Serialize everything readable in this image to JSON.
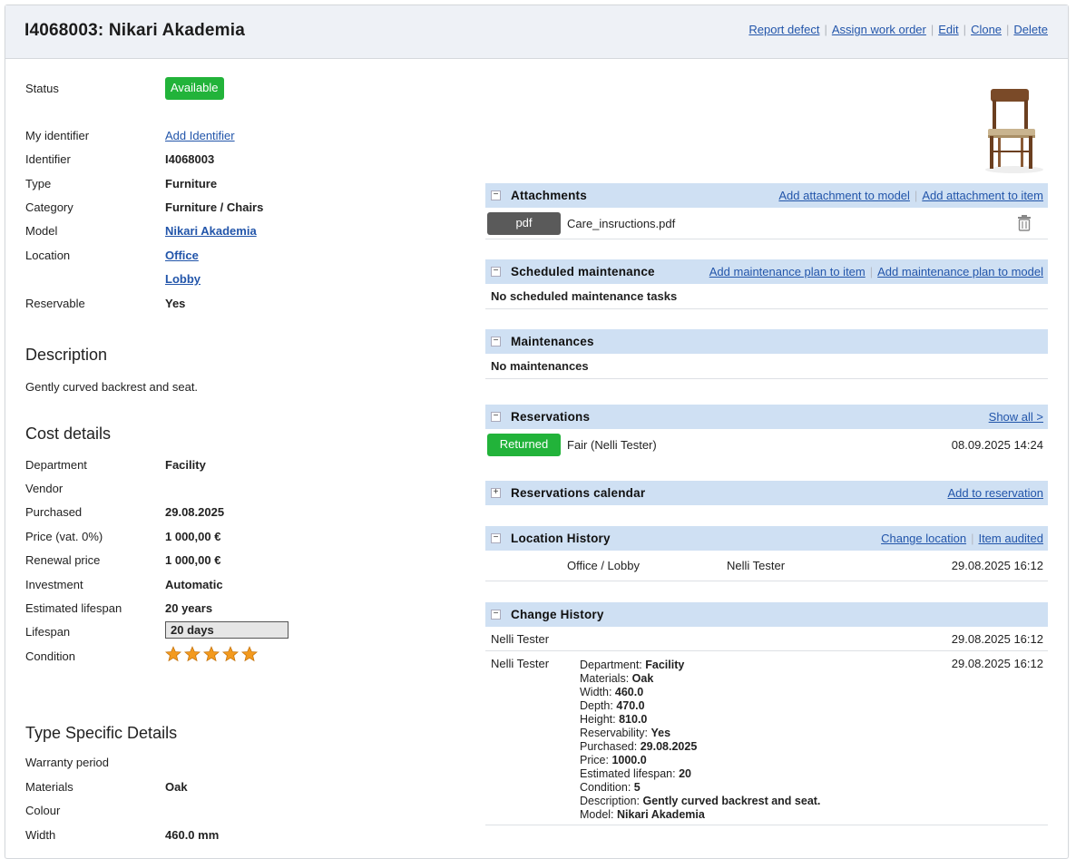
{
  "header": {
    "title": "I4068003: Nikari Akademia",
    "actions": [
      "Report defect",
      "Assign work order",
      "Edit",
      "Clone",
      "Delete"
    ]
  },
  "item": {
    "status_label": "Status",
    "status_value": "Available",
    "my_identifier_label": "My identifier",
    "my_identifier_link": "Add Identifier",
    "identifier_label": "Identifier",
    "identifier_value": "I4068003",
    "type_label": "Type",
    "type_value": "Furniture",
    "category_label": "Category",
    "category_value": "Furniture / Chairs",
    "model_label": "Model",
    "model_value": "Nikari Akademia",
    "location_label": "Location",
    "location_1": "Office",
    "location_2": "Lobby",
    "reservable_label": "Reservable",
    "reservable_value": "Yes"
  },
  "description": {
    "heading": "Description",
    "text": "Gently curved backrest and seat."
  },
  "cost": {
    "heading": "Cost details",
    "department_label": "Department",
    "department_value": "Facility",
    "vendor_label": "Vendor",
    "purchased_label": "Purchased",
    "purchased_value": "29.08.2025",
    "price_label": "Price (vat. 0%)",
    "price_value": "1 000,00 €",
    "renewal_label": "Renewal price",
    "renewal_value": "1 000,00 €",
    "investment_label": "Investment",
    "investment_value": "Automatic",
    "est_lifespan_label": "Estimated lifespan",
    "est_lifespan_value": "20 years",
    "lifespan_label": "Lifespan",
    "lifespan_value": "20 days",
    "condition_label": "Condition",
    "condition_stars": 5,
    "star_color": "#f39a1e"
  },
  "type_specific": {
    "heading": "Type Specific Details",
    "warranty_label": "Warranty period",
    "materials_label": "Materials",
    "materials_value": "Oak",
    "colour_label": "Colour",
    "width_label": "Width",
    "width_value": "460.0 mm"
  },
  "attachments": {
    "title": "Attachments",
    "links": [
      "Add attachment to model",
      "Add attachment to item"
    ],
    "file_type": "pdf",
    "file_name": "Care_insructions.pdf"
  },
  "scheduled": {
    "title": "Scheduled maintenance",
    "links": [
      "Add maintenance plan to item",
      "Add maintenance plan to model"
    ],
    "empty": "No scheduled maintenance tasks"
  },
  "maintenances": {
    "title": "Maintenances",
    "empty": "No maintenances"
  },
  "reservations": {
    "title": "Reservations",
    "link": "Show all >",
    "status": "Returned",
    "who": "Fair (Nelli Tester)",
    "date": "08.09.2025 14:24"
  },
  "calendar": {
    "title": "Reservations calendar",
    "link": "Add to reservation"
  },
  "location_history": {
    "title": "Location History",
    "links": [
      "Change location",
      "Item audited"
    ],
    "place": "Office / Lobby",
    "user": "Nelli Tester",
    "date": "29.08.2025 16:12"
  },
  "change_history": {
    "title": "Change History",
    "row1_user": "Nelli Tester",
    "row1_date": "29.08.2025 16:12",
    "row2_user": "Nelli Tester",
    "row2_date": "29.08.2025 16:12",
    "changes": [
      {
        "k": "Department:",
        "v": "Facility"
      },
      {
        "k": "Materials:",
        "v": "Oak"
      },
      {
        "k": "Width:",
        "v": "460.0"
      },
      {
        "k": "Depth:",
        "v": "470.0"
      },
      {
        "k": "Height:",
        "v": "810.0"
      },
      {
        "k": "Reservability:",
        "v": "Yes"
      },
      {
        "k": "Purchased:",
        "v": "29.08.2025"
      },
      {
        "k": "Price:",
        "v": "1000.0"
      },
      {
        "k": "Estimated lifespan:",
        "v": "20"
      },
      {
        "k": "Condition:",
        "v": "5"
      },
      {
        "k": "Description:",
        "v": "Gently curved backrest and seat."
      },
      {
        "k": "Model:",
        "v": "Nikari Akademia"
      }
    ]
  }
}
